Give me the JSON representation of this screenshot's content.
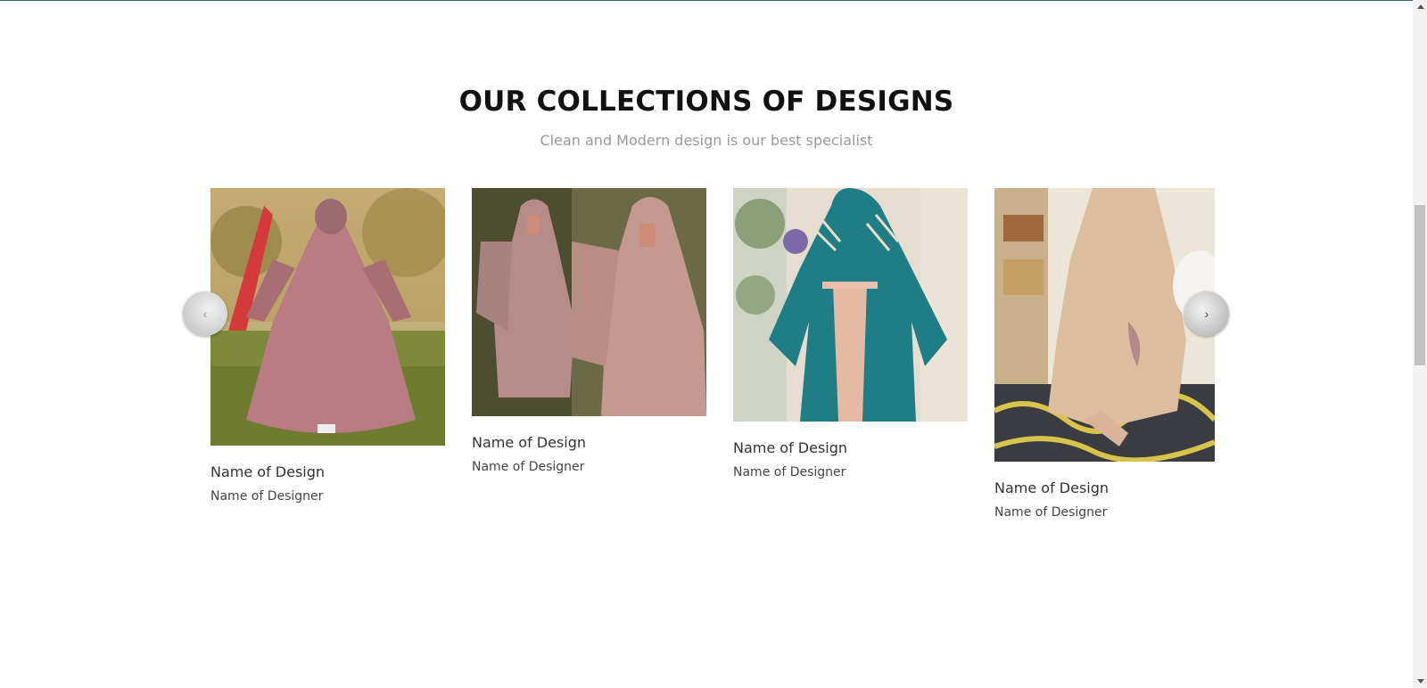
{
  "section": {
    "title": "OUR COLLECTIONS OF DESIGNS",
    "subtitle": "Clean and Modern design is our best specialist"
  },
  "carousel": {
    "prev_label": "‹",
    "next_label": "›",
    "cards": [
      {
        "title": "Name of Design",
        "designer": "Name of Designer"
      },
      {
        "title": "Name of Design",
        "designer": "Name of Designer"
      },
      {
        "title": "Name of Design",
        "designer": "Name of Designer"
      },
      {
        "title": "Name of Design",
        "designer": "Name of Designer"
      }
    ]
  },
  "colors": {
    "heading": "#111111",
    "subtitle": "#9a9a9a",
    "topline": "#2f6b73"
  }
}
